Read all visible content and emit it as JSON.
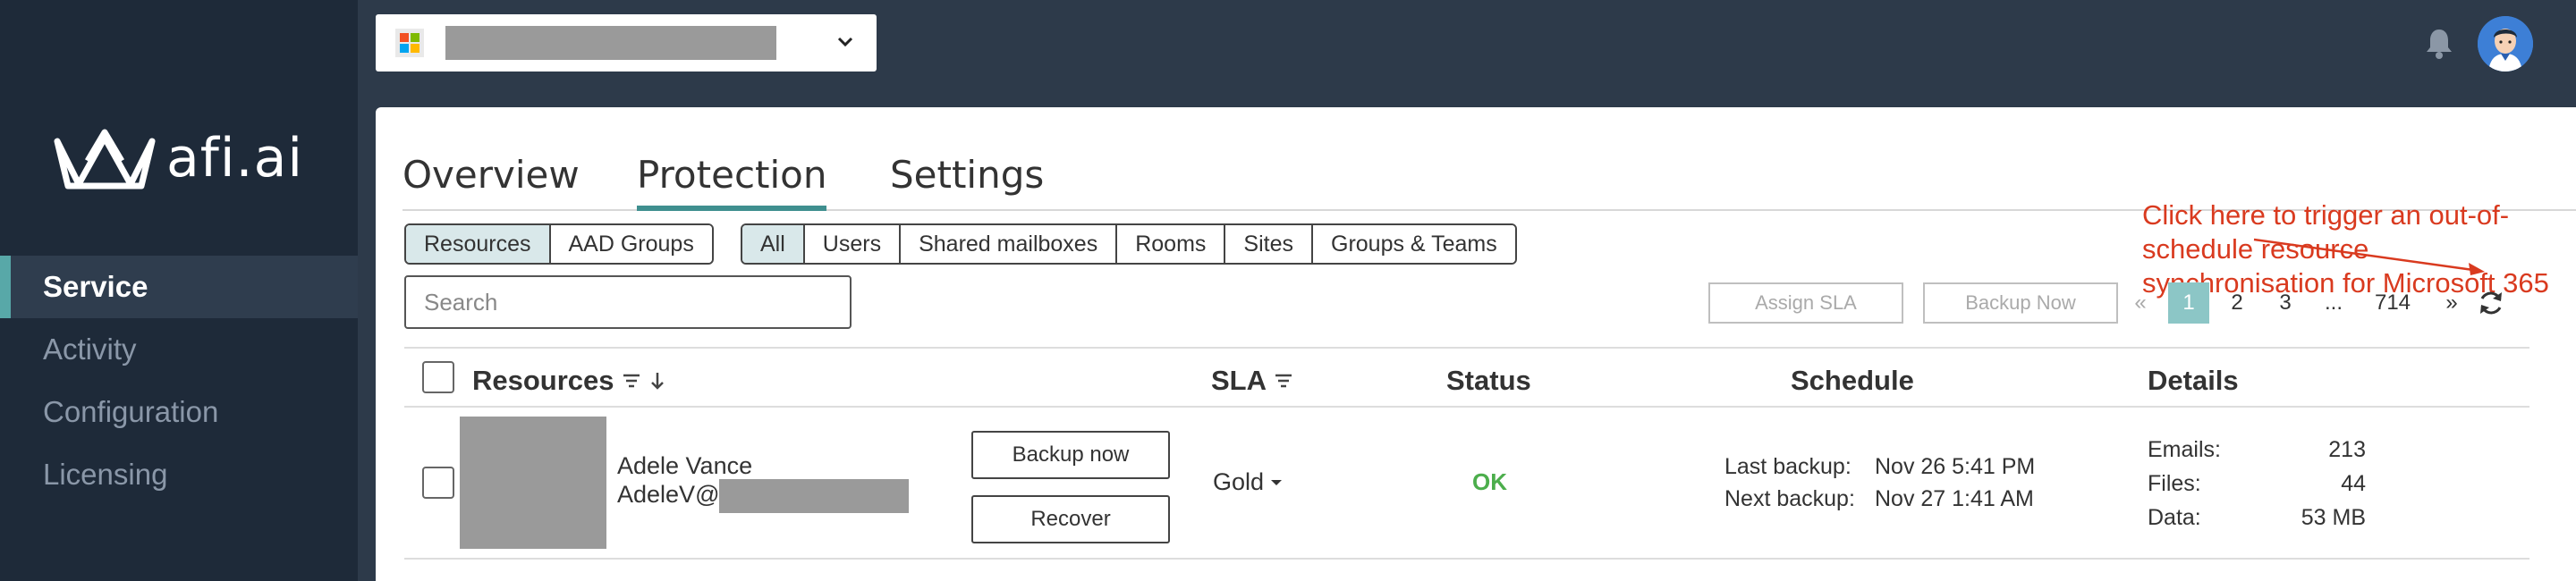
{
  "brand": {
    "logo_text": "afi.ai"
  },
  "sidebar": {
    "items": [
      {
        "label": "Service",
        "active": true
      },
      {
        "label": "Activity",
        "active": false
      },
      {
        "label": "Configuration",
        "active": false
      },
      {
        "label": "Licensing",
        "active": false
      }
    ]
  },
  "topbar": {
    "tenant_icon": "microsoft-icon",
    "dropdown_icon": "chevron-down-icon",
    "notification_icon": "bell-icon",
    "avatar_icon": "user-avatar"
  },
  "tabs": [
    {
      "label": "Overview",
      "active": false
    },
    {
      "label": "Protection",
      "active": true
    },
    {
      "label": "Settings",
      "active": false
    }
  ],
  "scope_filter": [
    {
      "label": "Resources",
      "active": true
    },
    {
      "label": "AAD Groups",
      "active": false
    }
  ],
  "type_filter": [
    {
      "label": "All",
      "active": true
    },
    {
      "label": "Users",
      "active": false
    },
    {
      "label": "Shared mailboxes",
      "active": false
    },
    {
      "label": "Rooms",
      "active": false
    },
    {
      "label": "Sites",
      "active": false
    },
    {
      "label": "Groups & Teams",
      "active": false
    }
  ],
  "search": {
    "placeholder": "Search",
    "value": ""
  },
  "actions": {
    "assign_sla": "Assign SLA",
    "backup_now": "Backup Now"
  },
  "pagination": {
    "prev": "«",
    "pages": [
      "1",
      "2",
      "3",
      "...",
      "714"
    ],
    "current": "1",
    "next": "»",
    "refresh_icon": "refresh-icon"
  },
  "annotation": {
    "line1": "Click here to trigger an out-of-schedule resource",
    "line2": "synchronisation for Microsoft 365",
    "color": "#d93a1f"
  },
  "table": {
    "headers": {
      "resources": "Resources",
      "sla": "SLA",
      "status": "Status",
      "schedule": "Schedule",
      "details": "Details"
    },
    "rows": [
      {
        "name": "Adele Vance",
        "email_prefix": "AdeleV@",
        "backup_now": "Backup now",
        "recover": "Recover",
        "sla": "Gold",
        "status": "OK",
        "last_backup_label": "Last backup:",
        "last_backup": "Nov 26 5:41 PM",
        "next_backup_label": "Next backup:",
        "next_backup": "Nov 27 1:41 AM",
        "details": [
          {
            "label": "Emails:",
            "value": "213"
          },
          {
            "label": "Files:",
            "value": "44"
          },
          {
            "label": "Data:",
            "value": "53 MB"
          }
        ]
      }
    ]
  },
  "colors": {
    "sidebar_bg": "#1e2a39",
    "topbar_bg": "#2d3a4a",
    "accent": "#3f8f8f",
    "status_ok": "#4cae4c"
  }
}
